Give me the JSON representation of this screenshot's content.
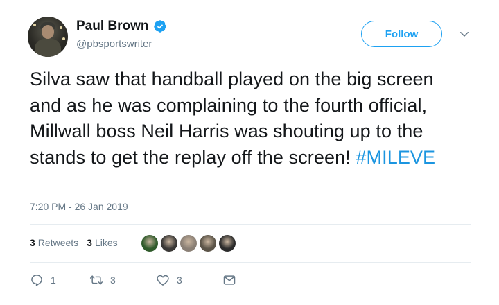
{
  "author": {
    "name": "Paul Brown",
    "handle": "@pbsportswriter",
    "verified": true
  },
  "follow_button": {
    "label": "Follow"
  },
  "tweet": {
    "text": "Silva saw that handball played on the big screen and as he was complaining to the fourth official, Millwall boss Neil Harris was shouting up to the stands to get the replay off the screen! ",
    "hashtag": "#MILEVE",
    "timestamp": "7:20 PM - 26 Jan 2019"
  },
  "stats": {
    "retweets_count": "3",
    "retweets_label": "Retweets",
    "likes_count": "3",
    "likes_label": "Likes"
  },
  "liker_avatars": [
    {
      "color": "#2f5a2a"
    },
    {
      "color": "#3a3836"
    },
    {
      "color": "#8a7f75"
    },
    {
      "color": "#5b5448"
    },
    {
      "color": "#2b2b2b"
    }
  ],
  "actions": {
    "reply_count": "1",
    "retweet_count": "3",
    "like_count": "3"
  },
  "colors": {
    "accent": "#1da1f2",
    "hashtag": "#1b95e0",
    "secondary_text": "#657786",
    "primary_text": "#14171a",
    "divider": "#e6ecf0"
  }
}
